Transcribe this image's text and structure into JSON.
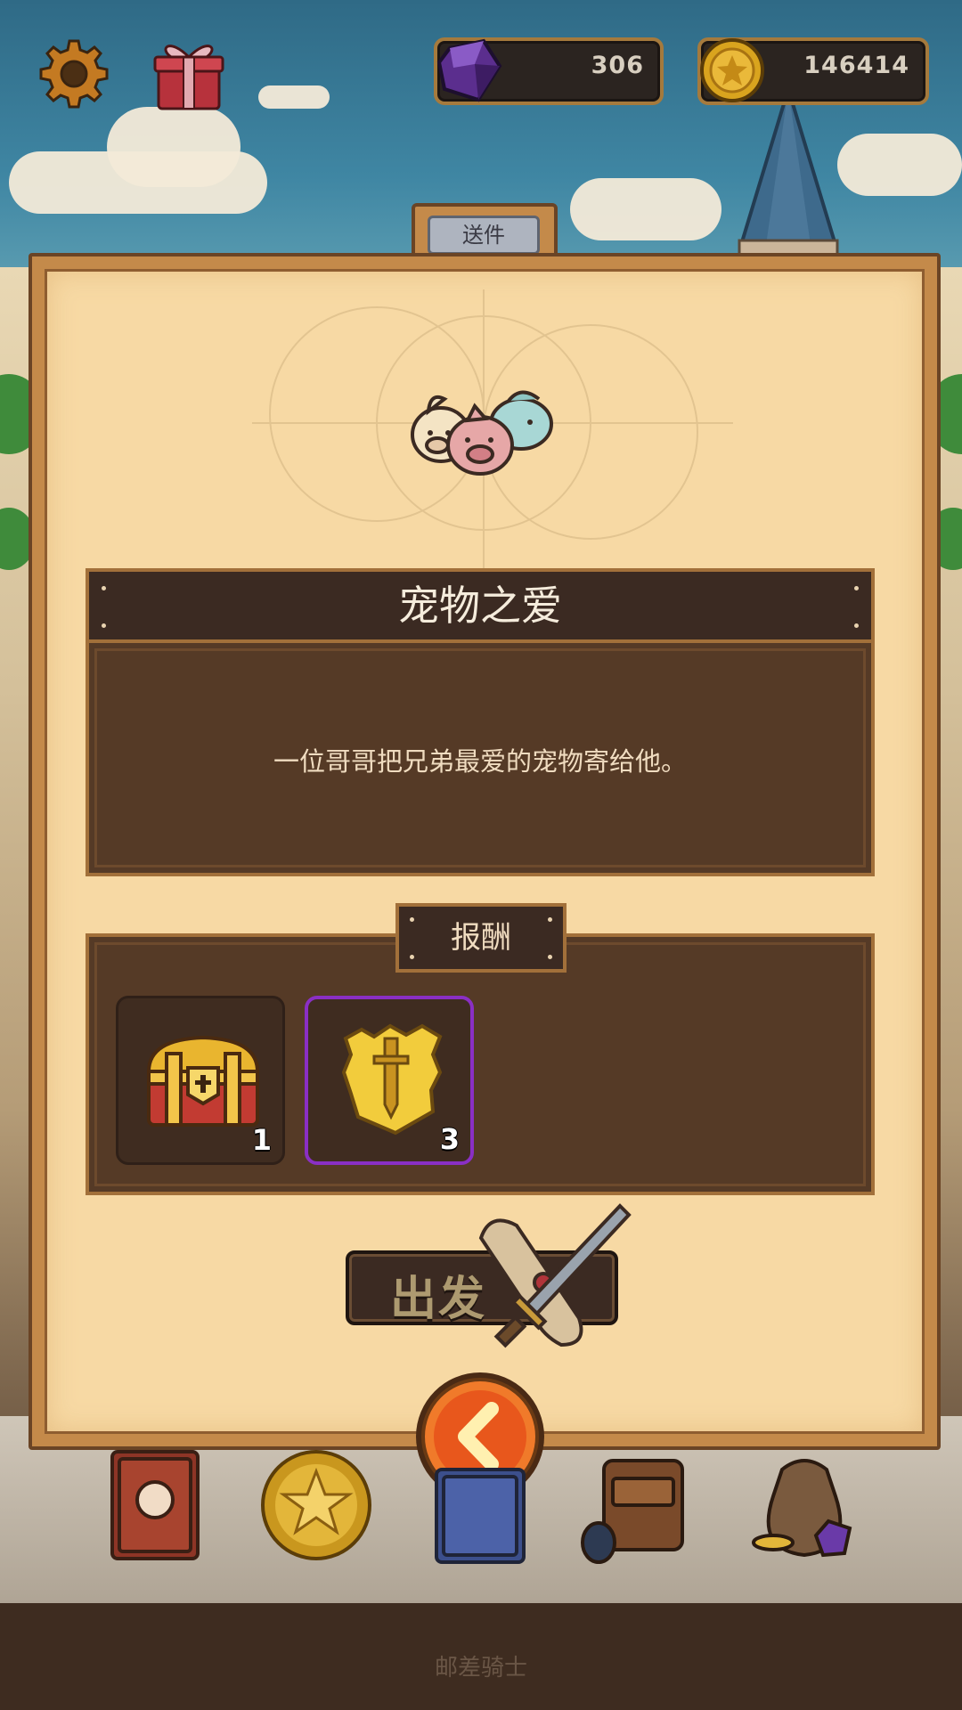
{
  "hud": {
    "gems": "306",
    "coins": "146414",
    "gem_icon": "purple-gem-icon",
    "coin_icon": "gold-coin-icon",
    "settings_icon": "gear-icon",
    "gift_icon": "gift-icon"
  },
  "dialog": {
    "tab_label": "送件",
    "quest_title": "宠物之爱",
    "quest_description": "一位哥哥把兄弟最爱的宠物寄给他。",
    "reward_header": "报酬",
    "rewards": [
      {
        "icon": "treasure-chest-icon",
        "count": "1",
        "rarity_color": "#2f2018"
      },
      {
        "icon": "gold-sword-emblem-icon",
        "count": "3",
        "rarity_color": "#8a2fc4"
      }
    ],
    "depart_label": "出发",
    "back_icon": "back-arrow-icon"
  },
  "bottom_nav": {
    "items": [
      "book-icon",
      "star-coin-icon",
      "scroll-book-icon",
      "backpack-icon",
      "treasure-bag-icon"
    ],
    "footer_label": "邮差骑士"
  },
  "colors": {
    "panel": "#c48a4a",
    "parchment": "#f7d9a4",
    "dark_wood": "#553a26",
    "accent_orange": "#e8571c"
  }
}
